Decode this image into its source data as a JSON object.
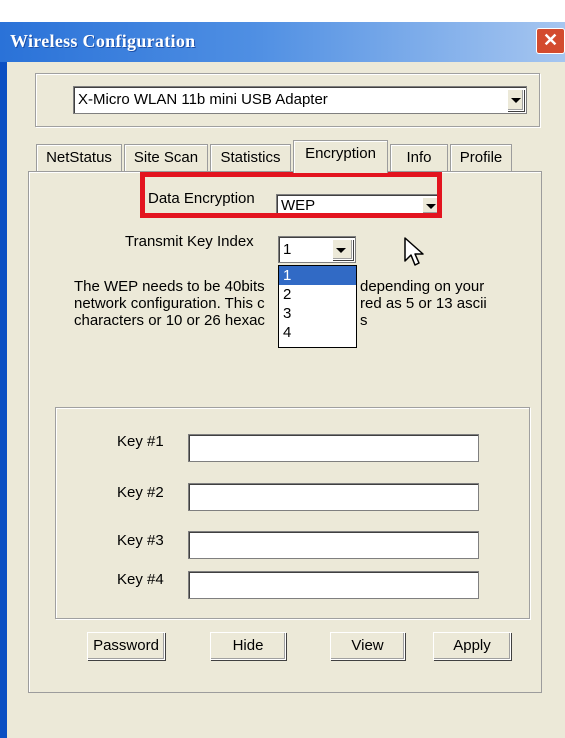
{
  "window": {
    "title": "Wireless Configuration",
    "close_glyph": "✕"
  },
  "adapter": {
    "selected": "X-Micro WLAN 11b mini USB Adapter"
  },
  "tabs": [
    {
      "label": "NetStatus",
      "active": false
    },
    {
      "label": "Site Scan",
      "active": false
    },
    {
      "label": "Statistics",
      "active": false
    },
    {
      "label": "Encryption",
      "active": true
    },
    {
      "label": "Info",
      "active": false
    },
    {
      "label": "Profile",
      "active": false
    }
  ],
  "encryption": {
    "data_encryption_label": "Data Encryption",
    "data_encryption_value": "WEP",
    "transmit_key_index_label": "Transmit Key Index",
    "transmit_key_index_value": "1",
    "key_index_options": [
      "1",
      "2",
      "3",
      "4"
    ],
    "key_index_highlighted": "1",
    "description_lines": [
      "The WEP needs to be 40bits",
      "network configuration. This c",
      "characters or 10 or 26 hexac"
    ],
    "description_right_lines": [
      "depending on your",
      "red as 5 or 13 ascii",
      "s"
    ],
    "keys": [
      {
        "label": "Key #1",
        "value": ""
      },
      {
        "label": "Key #2",
        "value": ""
      },
      {
        "label": "Key #3",
        "value": ""
      },
      {
        "label": "Key #4",
        "value": ""
      }
    ]
  },
  "buttons": {
    "password": "Password",
    "hide": "Hide",
    "view": "View",
    "apply": "Apply"
  },
  "colors": {
    "titlebar": "#2a72d8",
    "highlight_box": "#e3141f",
    "selection": "#316ac5"
  }
}
